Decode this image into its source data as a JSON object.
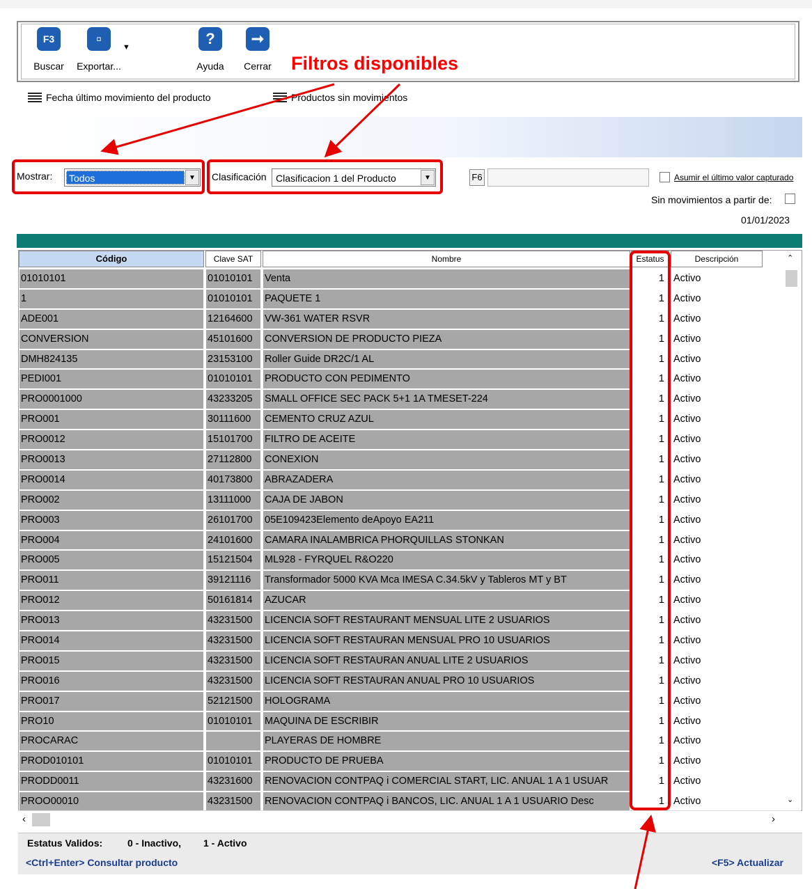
{
  "toolbar": {
    "buscar_label": "Buscar",
    "buscar_icon_text": "F3",
    "exportar_label": "Exportar...",
    "ayuda_label": "Ayuda",
    "ayuda_icon_text": "?",
    "cerrar_label": "Cerrar"
  },
  "annotation": {
    "title": "Filtros disponibles",
    "color": "#ff0000"
  },
  "filters": {
    "fecha_label": "Fecha último movimiento del producto",
    "sin_movs_label": "Productos sin movimientos"
  },
  "controls": {
    "mostrar_label": "Mostrar:",
    "mostrar_value": "Todos",
    "clasificacion_label": "Clasificación",
    "clasificacion_value": "Clasificacion 1 del Producto",
    "f6_label": "F6",
    "asumir_label": "Asumir el último valor capturado",
    "sin_mov_label": "Sin movimientos a partir de:",
    "date_value": "01/01/2023"
  },
  "grid": {
    "columns": [
      "Código",
      "Clave SAT",
      "Nombre",
      "Estatus",
      "Descripción"
    ],
    "rows": [
      {
        "codigo": "01010101",
        "clave": "01010101",
        "nombre": "Venta",
        "estatus": "1",
        "desc": "Activo"
      },
      {
        "codigo": "1",
        "clave": "01010101",
        "nombre": "PAQUETE 1",
        "estatus": "1",
        "desc": "Activo"
      },
      {
        "codigo": "ADE001",
        "clave": "12164600",
        "nombre": "VW-361 WATER RSVR",
        "estatus": "1",
        "desc": "Activo"
      },
      {
        "codigo": "CONVERSION",
        "clave": "45101600",
        "nombre": "CONVERSION DE PRODUCTO PIEZA",
        "estatus": "1",
        "desc": "Activo"
      },
      {
        "codigo": "DMH824135",
        "clave": "23153100",
        "nombre": "Roller Guide DR2C/1 AL",
        "estatus": "1",
        "desc": "Activo"
      },
      {
        "codigo": "PEDI001",
        "clave": "01010101",
        "nombre": "PRODUCTO CON PEDIMENTO",
        "estatus": "1",
        "desc": "Activo"
      },
      {
        "codigo": "PRO0001000",
        "clave": "43233205",
        "nombre": "SMALL OFFICE SEC PACK 5+1 1A TMESET-224",
        "estatus": "1",
        "desc": "Activo"
      },
      {
        "codigo": "PRO001",
        "clave": "30111600",
        "nombre": "CEMENTO CRUZ AZUL",
        "estatus": "1",
        "desc": "Activo"
      },
      {
        "codigo": "PRO0012",
        "clave": "15101700",
        "nombre": "FILTRO DE ACEITE",
        "estatus": "1",
        "desc": "Activo"
      },
      {
        "codigo": "PRO0013",
        "clave": "27112800",
        "nombre": "CONEXION",
        "estatus": "1",
        "desc": "Activo"
      },
      {
        "codigo": "PRO0014",
        "clave": "40173800",
        "nombre": "ABRAZADERA",
        "estatus": "1",
        "desc": "Activo"
      },
      {
        "codigo": "PRO002",
        "clave": "13111000",
        "nombre": "CAJA DE JABON",
        "estatus": "1",
        "desc": "Activo"
      },
      {
        "codigo": "PRO003",
        "clave": "26101700",
        "nombre": "05E109423Elemento deApoyo EA211",
        "estatus": "1",
        "desc": "Activo"
      },
      {
        "codigo": "PRO004",
        "clave": "24101600",
        "nombre": "CAMARA INALAMBRICA PHORQUILLAS STONKAN",
        "estatus": "1",
        "desc": "Activo"
      },
      {
        "codigo": "PRO005",
        "clave": "15121504",
        "nombre": "ML928 - FYRQUEL R&O220",
        "estatus": "1",
        "desc": "Activo"
      },
      {
        "codigo": "PRO011",
        "clave": "39121116",
        "nombre": "Transformador 5000 KVA Mca IMESA C.34.5kV y Tableros MT y BT",
        "estatus": "1",
        "desc": "Activo"
      },
      {
        "codigo": "PRO012",
        "clave": "50161814",
        "nombre": "AZUCAR",
        "estatus": "1",
        "desc": "Activo"
      },
      {
        "codigo": "PRO013",
        "clave": "43231500",
        "nombre": "LICENCIA SOFT RESTAURANT MENSUAL LITE 2 USUARIOS",
        "estatus": "1",
        "desc": "Activo"
      },
      {
        "codigo": "PRO014",
        "clave": "43231500",
        "nombre": "LICENCIA SOFT RESTAURAN MENSUAL PRO 10 USUARIOS",
        "estatus": "1",
        "desc": "Activo"
      },
      {
        "codigo": "PRO015",
        "clave": "43231500",
        "nombre": "LICENCIA SOFT RESTAURAN ANUAL LITE 2 USUARIOS",
        "estatus": "1",
        "desc": "Activo"
      },
      {
        "codigo": "PRO016",
        "clave": "43231500",
        "nombre": "LICENCIA SOFT RESTAURAN ANUAL PRO 10 USUARIOS",
        "estatus": "1",
        "desc": "Activo"
      },
      {
        "codigo": "PRO017",
        "clave": "52121500",
        "nombre": "HOLOGRAMA",
        "estatus": "1",
        "desc": "Activo"
      },
      {
        "codigo": "PRO10",
        "clave": "01010101",
        "nombre": "MAQUINA DE ESCRIBIR",
        "estatus": "1",
        "desc": "Activo"
      },
      {
        "codigo": "PROCARAC",
        "clave": "",
        "nombre": "PLAYERAS DE HOMBRE",
        "estatus": "1",
        "desc": "Activo"
      },
      {
        "codigo": "PROD010101",
        "clave": "01010101",
        "nombre": "PRODUCTO DE PRUEBA",
        "estatus": "1",
        "desc": "Activo"
      },
      {
        "codigo": "PRODD0011",
        "clave": "43231600",
        "nombre": "RENOVACION CONTPAQ i COMERCIAL START, LIC. ANUAL 1 A 1 USUAR",
        "estatus": "1",
        "desc": "Activo"
      },
      {
        "codigo": "PROO00010",
        "clave": "43231500",
        "nombre": "RENOVACION CONTPAQ i BANCOS,  LIC.  ANUAL 1 A 1 USUARIO Desc",
        "estatus": "1",
        "desc": "Activo"
      }
    ]
  },
  "status": {
    "validos_label": "Estatus Validos:",
    "inactivo": "0 - Inactivo,",
    "activo": "1 - Activo",
    "consultar": "<Ctrl+Enter> Consultar producto",
    "actualizar": "<F5> Actualizar"
  },
  "colors": {
    "teal_band": "#0a7c72",
    "selection_blue": "#1e6fd9",
    "gray_cell": "#a7a7a7",
    "annotation_red": "#e60000"
  }
}
